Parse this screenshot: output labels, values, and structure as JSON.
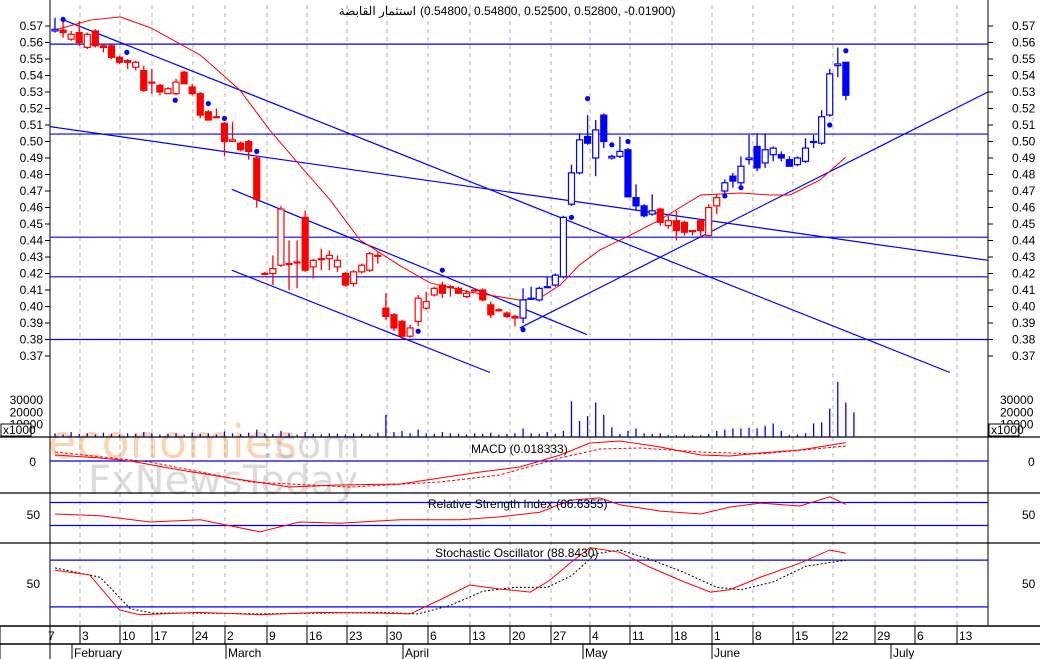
{
  "title": {
    "name": "استثمار القابضة",
    "ohlc": "(0.54800, 0.54800, 0.52500, 0.52800, -0.01900)"
  },
  "watermark": {
    "brand1": "economies",
    "brand1_suffix": ".com",
    "brand2": "FxNewsToday"
  },
  "colors": {
    "blue": "#0000ff",
    "red": "#ff0000",
    "grid": "#b0b0b0",
    "wm_orange": "#f6a25a"
  },
  "price_axis": {
    "labels": [
      "0.57",
      "0.56",
      "0.55",
      "0.54",
      "0.53",
      "0.52",
      "0.51",
      "0.50",
      "0.49",
      "0.48",
      "0.47",
      "0.46",
      "0.45",
      "0.44",
      "0.43",
      "0.42",
      "0.41",
      "0.40",
      "0.39",
      "0.38",
      "0.37"
    ]
  },
  "volume_axis": {
    "labels": [
      "30000",
      "20000",
      "10000"
    ],
    "unit": "x1000"
  },
  "x_axis": {
    "edge_label": "7",
    "weeks": [
      "3",
      "10",
      "17",
      "24",
      "2",
      "9",
      "16",
      "23",
      "30",
      "6",
      "13",
      "20",
      "27",
      "4",
      "11",
      "18",
      "1",
      "8",
      "15",
      "22",
      "29",
      "6",
      "13"
    ],
    "months": [
      "February",
      "March",
      "April",
      "May",
      "June",
      "July"
    ]
  },
  "indicators": {
    "macd": {
      "label": "MACD (0.018333)",
      "axis": "0"
    },
    "rsi": {
      "label": "Relative Strength Index (66.6355)",
      "axis": "50"
    },
    "stoch": {
      "label": "Stochastic Oscillator (88.8430)",
      "axis": "50"
    }
  },
  "chart_data": {
    "type": "candlestick",
    "ylim": [
      0.365,
      0.582
    ],
    "candles": [
      [
        0.567,
        0.575,
        0.566,
        0.568,
        "b"
      ],
      [
        0.5675,
        0.575,
        0.563,
        0.566,
        "r"
      ],
      [
        0.562,
        0.567,
        0.561,
        0.565,
        "r"
      ],
      [
        0.566,
        0.573,
        0.558,
        0.56,
        "r"
      ],
      [
        0.557,
        0.566,
        0.556,
        0.565,
        "r"
      ],
      [
        0.567,
        0.568,
        0.557,
        0.558,
        "r"
      ],
      [
        0.558,
        0.559,
        0.554,
        0.557,
        "r"
      ],
      [
        0.558,
        0.559,
        0.55,
        0.551,
        "r"
      ],
      [
        0.551,
        0.552,
        0.547,
        0.548,
        "r"
      ],
      [
        0.549,
        0.55,
        0.544,
        0.548,
        "r"
      ],
      [
        0.545,
        0.549,
        0.543,
        0.548,
        "r"
      ],
      [
        0.543,
        0.546,
        0.53,
        0.531,
        "r"
      ],
      [
        0.536,
        0.544,
        0.529,
        0.536,
        "r"
      ],
      [
        0.534,
        0.535,
        0.528,
        0.53,
        "r"
      ],
      [
        0.529,
        0.533,
        0.529,
        0.532,
        "r"
      ],
      [
        0.529,
        0.538,
        0.528,
        0.536,
        "r"
      ],
      [
        0.542,
        0.543,
        0.535,
        0.535,
        "r"
      ],
      [
        0.533,
        0.535,
        0.528,
        0.529,
        "r"
      ],
      [
        0.529,
        0.53,
        0.514,
        0.516,
        "r"
      ],
      [
        0.518,
        0.519,
        0.513,
        0.513,
        "r"
      ],
      [
        0.515,
        0.52,
        0.515,
        0.515,
        "r"
      ],
      [
        0.511,
        0.512,
        0.491,
        0.5,
        "r"
      ],
      [
        0.5,
        0.512,
        0.5,
        0.501,
        "r"
      ],
      [
        0.499,
        0.5,
        0.494,
        0.495,
        "r"
      ],
      [
        0.5,
        0.501,
        0.489,
        0.494,
        "r"
      ],
      [
        0.49,
        0.491,
        0.46,
        0.465,
        "r"
      ],
      [
        0.42,
        0.421,
        0.419,
        0.42,
        "r"
      ],
      [
        0.42,
        0.431,
        0.413,
        0.423,
        "r"
      ],
      [
        0.425,
        0.461,
        0.424,
        0.459,
        "r"
      ],
      [
        0.426,
        0.44,
        0.41,
        0.426,
        "r"
      ],
      [
        0.427,
        0.44,
        0.411,
        0.427,
        "r"
      ],
      [
        0.454,
        0.458,
        0.421,
        0.422,
        "r"
      ],
      [
        0.424,
        0.429,
        0.417,
        0.428,
        "r"
      ],
      [
        0.429,
        0.435,
        0.422,
        0.429,
        "r"
      ],
      [
        0.429,
        0.434,
        0.422,
        0.431,
        "r"
      ],
      [
        0.424,
        0.431,
        0.421,
        0.428,
        "r"
      ],
      [
        0.42,
        0.421,
        0.412,
        0.413,
        "r"
      ],
      [
        0.414,
        0.422,
        0.412,
        0.421,
        "r"
      ],
      [
        0.421,
        0.426,
        0.42,
        0.425,
        "r"
      ],
      [
        0.422,
        0.433,
        0.421,
        0.432,
        "r"
      ],
      [
        0.431,
        0.433,
        0.426,
        0.431,
        "r"
      ],
      [
        0.399,
        0.408,
        0.392,
        0.394,
        "r"
      ],
      [
        0.395,
        0.396,
        0.385,
        0.387,
        "r"
      ],
      [
        0.391,
        0.392,
        0.38,
        0.382,
        "r"
      ],
      [
        0.382,
        0.389,
        0.381,
        0.387,
        "r"
      ],
      [
        0.391,
        0.407,
        0.388,
        0.405,
        "r"
      ],
      [
        0.399,
        0.409,
        0.398,
        0.403,
        "r"
      ],
      [
        0.407,
        0.412,
        0.406,
        0.411,
        "r"
      ],
      [
        0.413,
        0.415,
        0.405,
        0.408,
        "r"
      ],
      [
        0.412,
        0.413,
        0.406,
        0.412,
        "r"
      ],
      [
        0.411,
        0.412,
        0.408,
        0.408,
        "r"
      ],
      [
        0.406,
        0.41,
        0.405,
        0.408,
        "r"
      ],
      [
        0.41,
        0.411,
        0.409,
        0.41,
        "r"
      ],
      [
        0.41,
        0.411,
        0.403,
        0.404,
        "r"
      ],
      [
        0.401,
        0.403,
        0.393,
        0.395,
        "r"
      ],
      [
        0.398,
        0.399,
        0.397,
        0.398,
        "r"
      ],
      [
        0.396,
        0.397,
        0.393,
        0.394,
        "r"
      ],
      [
        0.394,
        0.395,
        0.388,
        0.393,
        "r"
      ],
      [
        0.393,
        0.411,
        0.39,
        0.404,
        "b"
      ],
      [
        0.4045,
        0.412,
        0.404,
        0.405,
        "b"
      ],
      [
        0.404,
        0.412,
        0.403,
        0.411,
        "b"
      ],
      [
        0.412,
        0.418,
        0.411,
        0.412,
        "b"
      ],
      [
        0.413,
        0.42,
        0.412,
        0.419,
        "b"
      ],
      [
        0.418,
        0.455,
        0.417,
        0.454,
        "b"
      ],
      [
        0.462,
        0.486,
        0.461,
        0.481,
        "b"
      ],
      [
        0.481,
        0.505,
        0.48,
        0.501,
        "b"
      ],
      [
        0.503,
        0.516,
        0.498,
        0.499,
        "b"
      ],
      [
        0.49,
        0.513,
        0.479,
        0.507,
        "b"
      ],
      [
        0.516,
        0.517,
        0.496,
        0.5,
        "b"
      ],
      [
        0.49,
        0.492,
        0.489,
        0.491,
        "b"
      ],
      [
        0.491,
        0.503,
        0.49,
        0.494,
        "b"
      ],
      [
        0.495,
        0.496,
        0.466,
        0.4665,
        "b"
      ],
      [
        0.466,
        0.474,
        0.458,
        0.461,
        "b"
      ],
      [
        0.461,
        0.462,
        0.454,
        0.455,
        "b"
      ],
      [
        0.456,
        0.468,
        0.455,
        0.458,
        "b"
      ],
      [
        0.459,
        0.46,
        0.449,
        0.451,
        "r"
      ],
      [
        0.449,
        0.455,
        0.447,
        0.452,
        "r"
      ],
      [
        0.452,
        0.458,
        0.44,
        0.446,
        "r"
      ],
      [
        0.451,
        0.452,
        0.443,
        0.445,
        "r"
      ],
      [
        0.446,
        0.446,
        0.443,
        0.446,
        "r"
      ],
      [
        0.452,
        0.453,
        0.442,
        0.446,
        "r"
      ],
      [
        0.443,
        0.462,
        0.442,
        0.46,
        "r"
      ],
      [
        0.461,
        0.468,
        0.456,
        0.466,
        "r"
      ],
      [
        0.47,
        0.477,
        0.468,
        0.475,
        "b"
      ],
      [
        0.479,
        0.481,
        0.472,
        0.476,
        "b"
      ],
      [
        0.475,
        0.491,
        0.472,
        0.485,
        "b"
      ],
      [
        0.489,
        0.504,
        0.486,
        0.49,
        "b"
      ],
      [
        0.497,
        0.505,
        0.482,
        0.484,
        "b"
      ],
      [
        0.487,
        0.505,
        0.484,
        0.495,
        "b"
      ],
      [
        0.492,
        0.497,
        0.488,
        0.496,
        "b"
      ],
      [
        0.492,
        0.494,
        0.488,
        0.49,
        "b"
      ],
      [
        0.489,
        0.491,
        0.485,
        0.485,
        "b"
      ],
      [
        0.486,
        0.491,
        0.485,
        0.49,
        "b"
      ],
      [
        0.488,
        0.502,
        0.487,
        0.496,
        "b"
      ],
      [
        0.5,
        0.504,
        0.496,
        0.5,
        "b"
      ],
      [
        0.499,
        0.519,
        0.498,
        0.515,
        "b"
      ],
      [
        0.516,
        0.544,
        0.515,
        0.541,
        "b"
      ],
      [
        0.546,
        0.557,
        0.539,
        0.547,
        "b"
      ],
      [
        0.548,
        0.548,
        0.525,
        0.528,
        "b"
      ]
    ],
    "volume_thousands": [
      3000,
      2000,
      4000,
      2500,
      3000,
      2000,
      3500,
      2500,
      2000,
      3000,
      2500,
      4000,
      3000,
      2000,
      2500,
      3000,
      2000,
      3500,
      2500,
      3000,
      2000,
      4500,
      3000,
      2500,
      3500,
      6000,
      3000,
      2500,
      5000,
      3000,
      2000,
      4000,
      2500,
      2000,
      3000,
      2500,
      2000,
      3000,
      2500,
      2000,
      3500,
      18000,
      4000,
      5000,
      3000,
      6000,
      3000,
      2500,
      4000,
      3000,
      2500,
      2000,
      3000,
      2500,
      3500,
      2000,
      2500,
      3000,
      7000,
      3000,
      2500,
      4000,
      2500,
      5000,
      29000,
      13000,
      17000,
      28000,
      18000,
      8000,
      2500,
      5000,
      7000,
      3000,
      2500,
      3000,
      1500,
      1500,
      2000,
      1500,
      1500,
      2500,
      5000,
      6000,
      7000,
      7000,
      7500,
      7000,
      9000,
      11000,
      5000,
      1500,
      2000,
      3000,
      11000,
      12000,
      23000,
      45000,
      28000,
      20000
    ],
    "moving_average": [
      [
        0,
        0.5676
      ],
      [
        4.4,
        0.5736
      ],
      [
        8.1,
        0.5755
      ],
      [
        11.9,
        0.5688
      ],
      [
        18,
        0.5524
      ],
      [
        22.9,
        0.5312
      ],
      [
        26.6,
        0.507
      ],
      [
        30.3,
        0.4858
      ],
      [
        34.1,
        0.4645
      ],
      [
        37.8,
        0.4403
      ],
      [
        42.6,
        0.4252
      ],
      [
        46.5,
        0.4142
      ],
      [
        51.4,
        0.4088
      ],
      [
        57.6,
        0.4039
      ],
      [
        60.1,
        0.4052
      ],
      [
        62.6,
        0.413
      ],
      [
        65,
        0.4252
      ],
      [
        67.5,
        0.4342
      ],
      [
        71.3,
        0.4433
      ],
      [
        74.9,
        0.4524
      ],
      [
        80,
        0.4676
      ],
      [
        84.9,
        0.4688
      ],
      [
        88.6,
        0.4676
      ],
      [
        91.1,
        0.4676
      ],
      [
        94.8,
        0.4767
      ],
      [
        98,
        0.4906
      ]
    ],
    "markers": [
      [
        1,
        0.574
      ],
      [
        8.9,
        0.554
      ],
      [
        14.9,
        0.525
      ],
      [
        19,
        0.523
      ],
      [
        21,
        0.514
      ],
      [
        25,
        0.494
      ],
      [
        45,
        0.385
      ],
      [
        48,
        0.422
      ],
      [
        58,
        0.386
      ],
      [
        64,
        0.454
      ],
      [
        66,
        0.526
      ],
      [
        69,
        0.498
      ],
      [
        71,
        0.5
      ],
      [
        83,
        0.467
      ],
      [
        85,
        0.472
      ],
      [
        96,
        0.51
      ],
      [
        98,
        0.555
      ]
    ],
    "horizontal_levels": [
      0.559,
      0.5045,
      0.442,
      0.418,
      0.38
    ],
    "trend_lines": [
      [
        [
          0.9,
          0.574
        ],
        [
          110.9,
          0.36
        ]
      ],
      [
        [
          -0.6,
          0.509
        ],
        [
          115.6,
          0.428
        ]
      ],
      [
        [
          21.9,
          0.471
        ],
        [
          65.9,
          0.383
        ]
      ],
      [
        [
          21.9,
          0.422
        ],
        [
          53.9,
          0.36
        ]
      ],
      [
        [
          57.6,
          0.387
        ],
        [
          115.6,
          0.53
        ]
      ]
    ],
    "macd": {
      "line": [
        [
          0,
          0.006
        ],
        [
          5.6,
          0.003
        ],
        [
          9.3,
          0
        ],
        [
          15.5,
          -0.009
        ],
        [
          21.7,
          -0.017
        ],
        [
          29.1,
          -0.026
        ],
        [
          35.3,
          -0.024
        ],
        [
          42.8,
          -0.023
        ],
        [
          47.7,
          -0.017
        ],
        [
          52.7,
          -0.011
        ],
        [
          57.6,
          -0.006
        ],
        [
          62.6,
          0.006
        ],
        [
          66.3,
          0.018
        ],
        [
          70,
          0.02
        ],
        [
          75,
          0.014
        ],
        [
          80,
          0.006
        ],
        [
          83.6,
          0.005
        ],
        [
          87.4,
          0.008
        ],
        [
          92.3,
          0.011
        ],
        [
          98,
          0.018333
        ]
      ],
      "signal": [
        [
          0,
          0.009
        ],
        [
          11.8,
          -0.001
        ],
        [
          24.2,
          -0.021
        ],
        [
          36.6,
          -0.026
        ],
        [
          47.7,
          -0.021
        ],
        [
          55.1,
          -0.014
        ],
        [
          62.6,
          0.003
        ],
        [
          67.5,
          0.012
        ],
        [
          72.5,
          0.013
        ],
        [
          80,
          0.009
        ],
        [
          87.4,
          0.007
        ],
        [
          98,
          0.015
        ]
      ]
    },
    "rsi": {
      "line": [
        [
          0,
          50
        ],
        [
          5.6,
          47
        ],
        [
          11.8,
          36
        ],
        [
          18,
          40
        ],
        [
          25.4,
          19
        ],
        [
          30.3,
          36
        ],
        [
          35.3,
          34
        ],
        [
          42.8,
          40
        ],
        [
          50.2,
          40
        ],
        [
          55.1,
          45
        ],
        [
          60.1,
          53
        ],
        [
          63.8,
          74
        ],
        [
          67.5,
          78
        ],
        [
          70,
          66
        ],
        [
          75,
          55
        ],
        [
          80,
          50
        ],
        [
          83.6,
          62
        ],
        [
          87.4,
          69
        ],
        [
          92.3,
          64
        ],
        [
          96,
          80
        ],
        [
          98,
          66.6
        ]
      ],
      "levels": [
        70,
        30
      ]
    },
    "stochastic": {
      "k": [
        [
          0,
          67
        ],
        [
          4.3,
          61
        ],
        [
          8,
          16
        ],
        [
          10.5,
          10
        ],
        [
          17.9,
          13
        ],
        [
          25.4,
          10
        ],
        [
          32.8,
          13
        ],
        [
          40.3,
          12
        ],
        [
          44,
          11
        ],
        [
          47.7,
          29
        ],
        [
          51.4,
          48
        ],
        [
          55.1,
          43
        ],
        [
          58.9,
          39
        ],
        [
          61.3,
          54
        ],
        [
          63.8,
          76
        ],
        [
          66.3,
          96
        ],
        [
          70,
          90
        ],
        [
          73.7,
          71
        ],
        [
          77.5,
          54
        ],
        [
          81.2,
          39
        ],
        [
          83.6,
          42
        ],
        [
          87.4,
          58
        ],
        [
          92.3,
          76
        ],
        [
          96,
          93
        ],
        [
          98,
          88.8
        ]
      ],
      "d": [
        [
          0,
          70
        ],
        [
          5.6,
          58
        ],
        [
          9.3,
          18
        ],
        [
          12,
          12
        ],
        [
          18,
          12
        ],
        [
          25.4,
          11
        ],
        [
          32.8,
          12
        ],
        [
          40.3,
          13
        ],
        [
          45,
          11
        ],
        [
          49,
          22
        ],
        [
          53,
          40
        ],
        [
          57,
          45
        ],
        [
          61,
          45
        ],
        [
          64,
          60
        ],
        [
          67,
          88
        ],
        [
          70,
          93
        ],
        [
          74,
          80
        ],
        [
          78,
          64
        ],
        [
          82,
          45
        ],
        [
          85,
          42
        ],
        [
          89,
          52
        ],
        [
          93,
          72
        ],
        [
          98,
          80
        ]
      ],
      "levels": [
        80,
        20
      ]
    }
  }
}
